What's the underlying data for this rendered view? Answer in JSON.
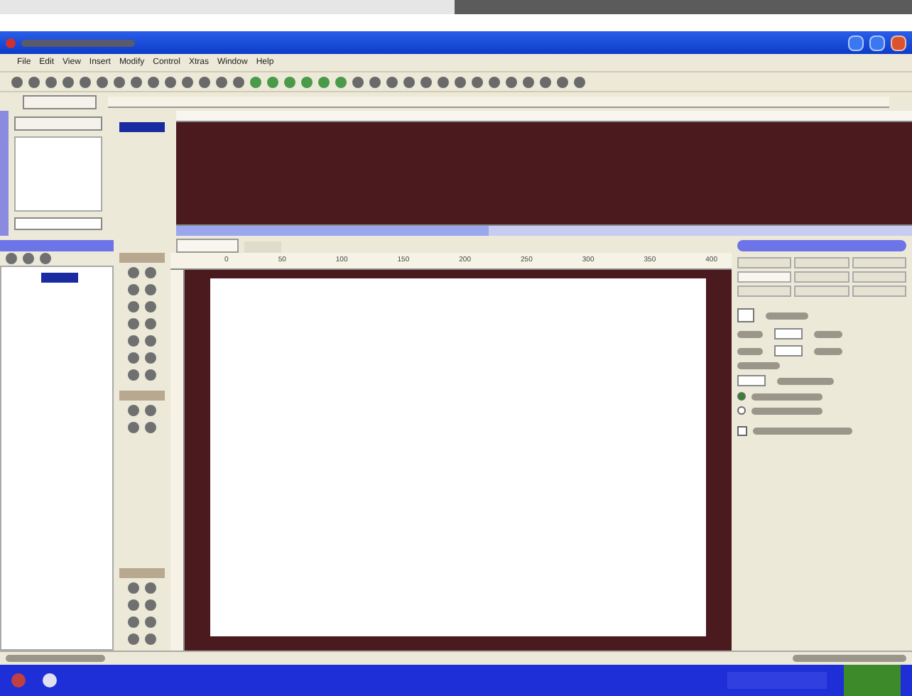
{
  "menu": [
    "File",
    "Edit",
    "View",
    "Insert",
    "Modify",
    "Control",
    "Xtras",
    "Window",
    "Help"
  ],
  "stage": {
    "ruler_ticks": [
      "0",
      "50",
      "100",
      "150",
      "200",
      "250",
      "300",
      "350",
      "400"
    ]
  },
  "inspector": {
    "tabs": [
      {
        "selected": false
      },
      {
        "selected": false
      },
      {
        "selected": false
      },
      {
        "selected": true
      },
      {
        "selected": false
      },
      {
        "selected": false
      },
      {
        "selected": false
      },
      {
        "selected": false
      },
      {
        "selected": false
      }
    ],
    "radios": [
      {
        "selected": true
      },
      {
        "selected": false
      }
    ],
    "checkbox": {
      "checked": false
    }
  }
}
